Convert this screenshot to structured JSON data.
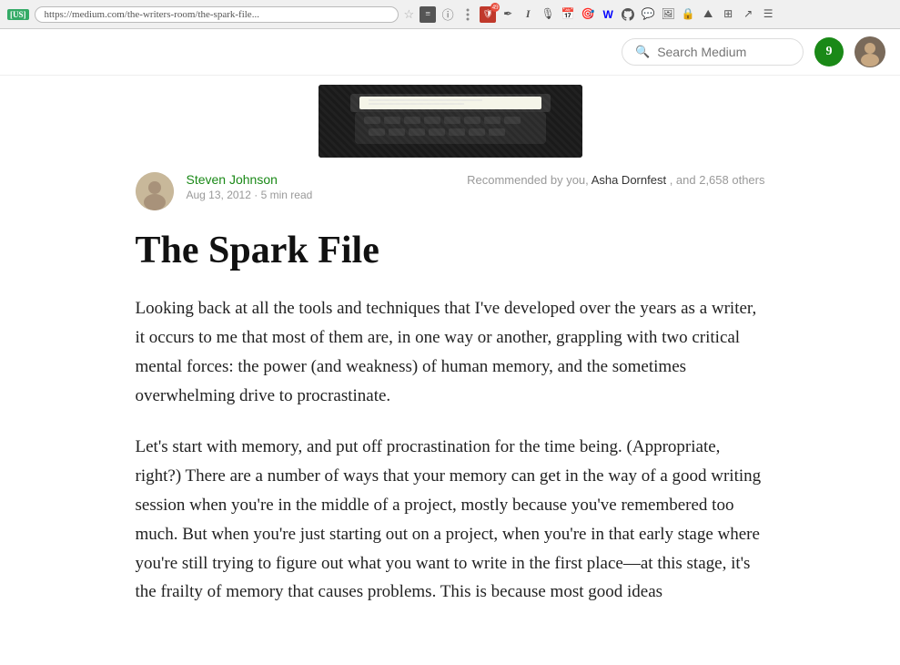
{
  "browser": {
    "flag": "[US]",
    "url": "https://medium.com/the-writers-room/the-spark-file...",
    "icons": [
      "stack",
      "info",
      "dots",
      "shield-49",
      "pen",
      "italic",
      "podcast",
      "calendar",
      "target",
      "W",
      "github",
      "chat",
      "image",
      "lock",
      "mountain",
      "grid",
      "ext",
      "menu"
    ]
  },
  "nav": {
    "search_placeholder": "Search Medium",
    "notification_count": "9"
  },
  "author": {
    "name": "Steven Johnson",
    "date": "Aug 13, 2012",
    "read_time": "5 min read",
    "recommendation_text": "Recommended by you,",
    "rec_name": "Asha Dornfest",
    "rec_suffix": ", and 2,658 others"
  },
  "article": {
    "title": "The Spark File",
    "body_p1": "Looking back at all the tools and techniques that I've developed over the years as a writer, it occurs to me that most of them are, in one way or another, grappling with two critical mental forces: the power (and weakness) of human memory, and the sometimes overwhelming drive to procrastinate.",
    "body_p2": "Let's start with memory, and put off procrastination for the time being. (Appropriate, right?) There are a number of ways that your memory can get in the way of a good writing session when you're in the middle of a project, mostly because you've remembered too much. But when you're just starting out on a project, when you're in that early stage where you're still trying to figure out what you want to write in the first place—at this stage, it's the frailty of memory that causes problems. This is because most good ideas"
  }
}
